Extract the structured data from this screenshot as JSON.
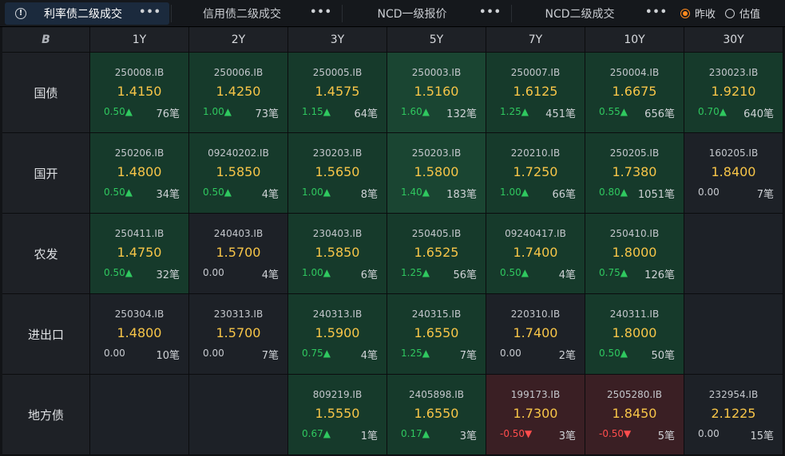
{
  "tabs": [
    {
      "label": "利率债二级成交",
      "more": "•••",
      "active": true
    },
    {
      "label": "信用债二级成交",
      "more": "•••",
      "active": false
    },
    {
      "label": "NCD一级报价",
      "more": "•••",
      "active": false
    },
    {
      "label": "NCD二级成交",
      "more": "•••",
      "active": false
    }
  ],
  "info_icon": "!",
  "radios": [
    {
      "label": "昨收",
      "checked": true
    },
    {
      "label": "估值",
      "checked": false
    }
  ],
  "corner_label": "B",
  "tenors": [
    "1Y",
    "2Y",
    "3Y",
    "5Y",
    "7Y",
    "10Y",
    "30Y"
  ],
  "rows": [
    {
      "name": "国债",
      "cells": [
        {
          "code": "250008.IB",
          "yield": "1.4150",
          "change": "0.50▲",
          "dir": "up",
          "count": "76笔",
          "bg": "g1"
        },
        {
          "code": "250006.IB",
          "yield": "1.4250",
          "change": "1.00▲",
          "dir": "up",
          "count": "73笔",
          "bg": "g1"
        },
        {
          "code": "250005.IB",
          "yield": "1.4575",
          "change": "1.15▲",
          "dir": "up",
          "count": "64笔",
          "bg": "g1"
        },
        {
          "code": "250003.IB",
          "yield": "1.5160",
          "change": "1.60▲",
          "dir": "up",
          "count": "132笔",
          "bg": "g2"
        },
        {
          "code": "250007.IB",
          "yield": "1.6125",
          "change": "1.25▲",
          "dir": "up",
          "count": "451笔",
          "bg": "g1"
        },
        {
          "code": "250004.IB",
          "yield": "1.6675",
          "change": "0.55▲",
          "dir": "up",
          "count": "656笔",
          "bg": "g1"
        },
        {
          "code": "230023.IB",
          "yield": "1.9210",
          "change": "0.70▲",
          "dir": "up",
          "count": "640笔",
          "bg": "g1"
        }
      ]
    },
    {
      "name": "国开",
      "cells": [
        {
          "code": "250206.IB",
          "yield": "1.4800",
          "change": "0.50▲",
          "dir": "up",
          "count": "34笔",
          "bg": "g1"
        },
        {
          "code": "09240202.IB",
          "yield": "1.5850",
          "change": "0.50▲",
          "dir": "up",
          "count": "4笔",
          "bg": "g1"
        },
        {
          "code": "230203.IB",
          "yield": "1.5650",
          "change": "1.00▲",
          "dir": "up",
          "count": "8笔",
          "bg": "g1"
        },
        {
          "code": "250203.IB",
          "yield": "1.5800",
          "change": "1.40▲",
          "dir": "up",
          "count": "183笔",
          "bg": "g2"
        },
        {
          "code": "220210.IB",
          "yield": "1.7250",
          "change": "1.00▲",
          "dir": "up",
          "count": "66笔",
          "bg": "g1"
        },
        {
          "code": "250205.IB",
          "yield": "1.7380",
          "change": "0.80▲",
          "dir": "up",
          "count": "1051笔",
          "bg": "g1"
        },
        {
          "code": "160205.IB",
          "yield": "1.8400",
          "change": "0.00",
          "dir": "flat",
          "count": "7笔",
          "bg": "neutral"
        }
      ]
    },
    {
      "name": "农发",
      "cells": [
        {
          "code": "250411.IB",
          "yield": "1.4750",
          "change": "0.50▲",
          "dir": "up",
          "count": "32笔",
          "bg": "g1"
        },
        {
          "code": "240403.IB",
          "yield": "1.5700",
          "change": "0.00",
          "dir": "flat",
          "count": "4笔",
          "bg": "neutral"
        },
        {
          "code": "230403.IB",
          "yield": "1.5850",
          "change": "1.00▲",
          "dir": "up",
          "count": "6笔",
          "bg": "g1"
        },
        {
          "code": "250405.IB",
          "yield": "1.6525",
          "change": "1.25▲",
          "dir": "up",
          "count": "56笔",
          "bg": "g1"
        },
        {
          "code": "09240417.IB",
          "yield": "1.7400",
          "change": "0.50▲",
          "dir": "up",
          "count": "4笔",
          "bg": "g1"
        },
        {
          "code": "250410.IB",
          "yield": "1.8000",
          "change": "0.75▲",
          "dir": "up",
          "count": "126笔",
          "bg": "g1"
        },
        null
      ]
    },
    {
      "name": "进出口",
      "cells": [
        {
          "code": "250304.IB",
          "yield": "1.4800",
          "change": "0.00",
          "dir": "flat",
          "count": "10笔",
          "bg": "neutral"
        },
        {
          "code": "230313.IB",
          "yield": "1.5700",
          "change": "0.00",
          "dir": "flat",
          "count": "7笔",
          "bg": "neutral"
        },
        {
          "code": "240313.IB",
          "yield": "1.5900",
          "change": "0.75▲",
          "dir": "up",
          "count": "4笔",
          "bg": "g1"
        },
        {
          "code": "240315.IB",
          "yield": "1.6550",
          "change": "1.25▲",
          "dir": "up",
          "count": "7笔",
          "bg": "g1"
        },
        {
          "code": "220310.IB",
          "yield": "1.7400",
          "change": "0.00",
          "dir": "flat",
          "count": "2笔",
          "bg": "neutral"
        },
        {
          "code": "240311.IB",
          "yield": "1.8000",
          "change": "0.50▲",
          "dir": "up",
          "count": "50笔",
          "bg": "g1"
        },
        null
      ]
    },
    {
      "name": "地方债",
      "cells": [
        null,
        null,
        {
          "code": "809219.IB",
          "yield": "1.5550",
          "change": "0.67▲",
          "dir": "up",
          "count": "1笔",
          "bg": "g1"
        },
        {
          "code": "2405898.IB",
          "yield": "1.6550",
          "change": "0.17▲",
          "dir": "up",
          "count": "3笔",
          "bg": "g1"
        },
        {
          "code": "199173.IB",
          "yield": "1.7300",
          "change": "-0.50▼",
          "dir": "down",
          "count": "3笔",
          "bg": "red"
        },
        {
          "code": "2505280.IB",
          "yield": "1.8450",
          "change": "-0.50▼",
          "dir": "down",
          "count": "5笔",
          "bg": "red"
        },
        {
          "code": "232954.IB",
          "yield": "2.1225",
          "change": "0.00",
          "dir": "flat",
          "count": "15笔",
          "bg": "neutral"
        }
      ]
    }
  ]
}
